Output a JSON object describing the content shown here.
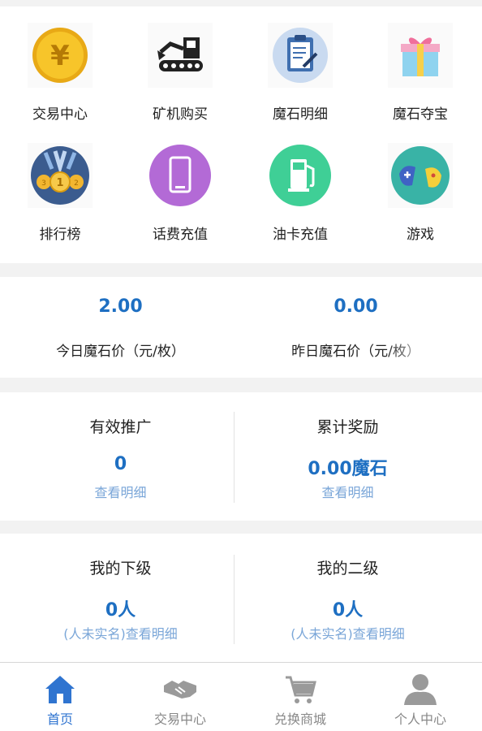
{
  "grid": [
    {
      "label": "交易中心",
      "icon": "gold-coin-yen-icon"
    },
    {
      "label": "矿机购买",
      "icon": "mining-machine-icon"
    },
    {
      "label": "魔石明细",
      "icon": "clipboard-icon"
    },
    {
      "label": "魔石夺宝",
      "icon": "gift-box-icon"
    },
    {
      "label": "排行榜",
      "icon": "medals-icon"
    },
    {
      "label": "话费充值",
      "icon": "phone-icon"
    },
    {
      "label": "油卡充值",
      "icon": "fuel-pump-icon"
    },
    {
      "label": "游戏",
      "icon": "gamepad-icon"
    }
  ],
  "price": {
    "today_value": "2.00",
    "today_label": "今日魔石价（元/枚）",
    "yesterday_value": "0.00",
    "yesterday_label": "昨日魔石价（元/枚）"
  },
  "promo": {
    "left_title": "有效推广",
    "left_value": "0",
    "left_link": "查看明细",
    "right_title": "累计奖励",
    "right_value": "0.00魔石",
    "right_link": "查看明细"
  },
  "team": {
    "left_title": "我的下级",
    "left_value": "0人",
    "left_link": "(人未实名)查看明细",
    "right_title": "我的二级",
    "right_value": "0人",
    "right_link": "(人未实名)查看明细"
  },
  "tabs": [
    {
      "label": "首页",
      "icon": "home-icon",
      "active": true
    },
    {
      "label": "交易中心",
      "icon": "handshake-icon",
      "active": false
    },
    {
      "label": "兑换商城",
      "icon": "cart-icon",
      "active": false
    },
    {
      "label": "个人中心",
      "icon": "user-icon",
      "active": false
    }
  ],
  "colors": {
    "accent": "#1e6fc2",
    "link": "#7aa6d8",
    "tab_active": "#2f74d0"
  }
}
